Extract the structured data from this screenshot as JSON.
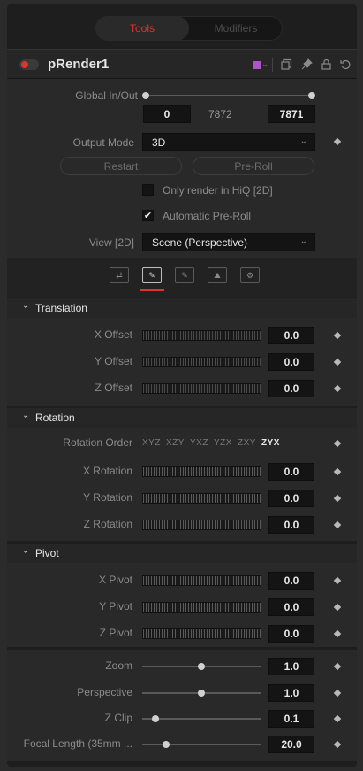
{
  "tabs": {
    "tools": "Tools",
    "modifiers": "Modifiers"
  },
  "header": {
    "node_name": "pRender1",
    "color_swatch": "#b052c9",
    "icons": [
      "color-dropdown-chevron-icon",
      "version-icon",
      "pin-icon",
      "lock-icon",
      "reset-icon"
    ]
  },
  "controls": {
    "global_inout": {
      "label": "Global In/Out",
      "in": "0",
      "mid": "7872",
      "out": "7871"
    },
    "output_mode": {
      "label": "Output Mode",
      "value": "3D"
    },
    "restart_label": "Restart",
    "preroll_label": "Pre-Roll",
    "only_hiq": {
      "label": "Only render in HiQ [2D]",
      "checked": false
    },
    "auto_preroll": {
      "label": "Automatic Pre-Roll",
      "checked": true
    },
    "view2d": {
      "label": "View [2D]",
      "value": "Scene (Perspective)"
    }
  },
  "subtabs": [
    "controls-tab-icon",
    "transform-tab-icon",
    "settings-tab-icon",
    "image-tab-icon",
    "scene-settings-tab-icon"
  ],
  "translation": {
    "title": "Translation",
    "rows": [
      {
        "label": "X Offset",
        "value": "0.0"
      },
      {
        "label": "Y Offset",
        "value": "0.0"
      },
      {
        "label": "Z Offset",
        "value": "0.0"
      }
    ]
  },
  "rotation": {
    "title": "Rotation",
    "order_label": "Rotation Order",
    "orders": [
      "XYZ",
      "XZY",
      "YXZ",
      "YZX",
      "ZXY",
      "ZYX"
    ],
    "selected_order": "ZYX",
    "rows": [
      {
        "label": "X Rotation",
        "value": "0.0"
      },
      {
        "label": "Y Rotation",
        "value": "0.0"
      },
      {
        "label": "Z Rotation",
        "value": "0.0"
      }
    ]
  },
  "pivot": {
    "title": "Pivot",
    "rows": [
      {
        "label": "X Pivot",
        "value": "0.0"
      },
      {
        "label": "Y Pivot",
        "value": "0.0"
      },
      {
        "label": "Z Pivot",
        "value": "0.0"
      }
    ]
  },
  "camera": {
    "rows": [
      {
        "label": "Zoom",
        "value": "1.0"
      },
      {
        "label": "Perspective",
        "value": "1.0"
      },
      {
        "label": "Z Clip",
        "value": "0.1"
      },
      {
        "label": "Focal Length (35mm ...",
        "value": "20.0"
      }
    ]
  },
  "colors": {
    "accent": "#e0332e",
    "panel": "#1e1e1e"
  }
}
